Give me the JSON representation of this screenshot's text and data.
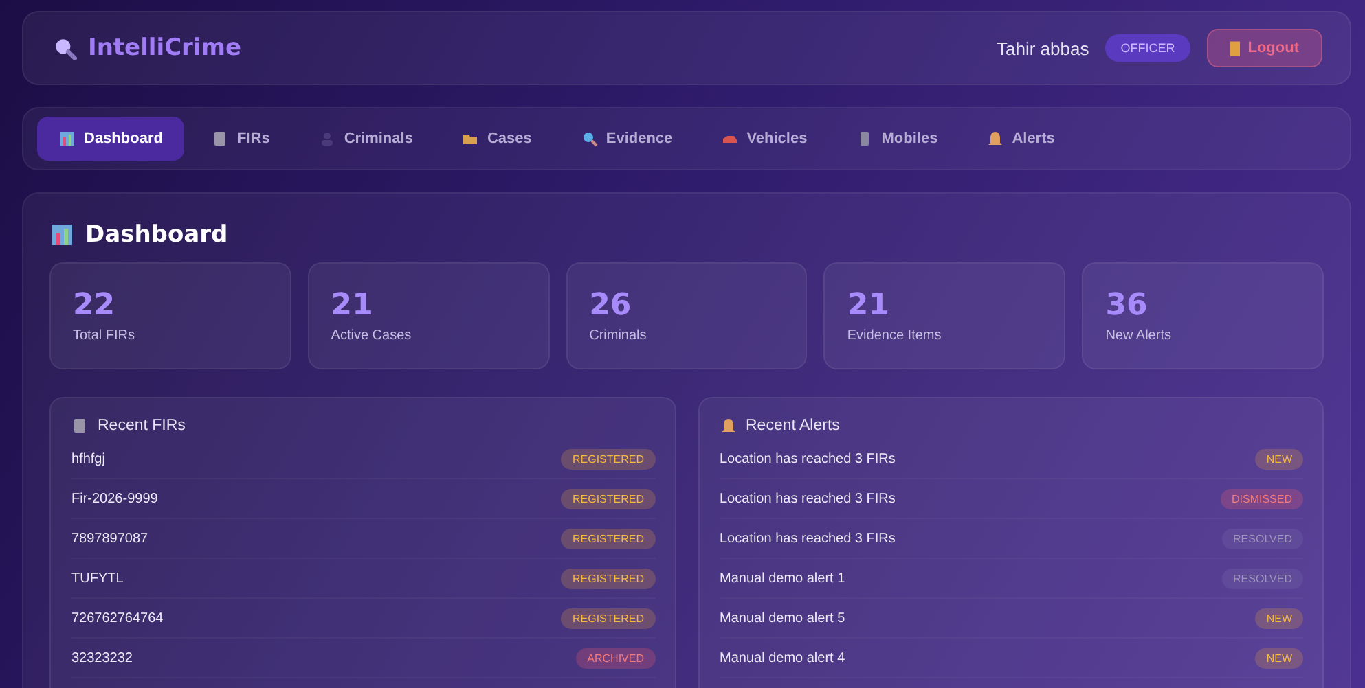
{
  "header": {
    "logo": "IntelliCrime",
    "user": "Tahir abbas",
    "role": "OFFICER",
    "logout": "Logout"
  },
  "nav": [
    {
      "label": "Dashboard",
      "selected": true
    },
    {
      "label": "FIRs",
      "selected": false
    },
    {
      "label": "Criminals",
      "selected": false
    },
    {
      "label": "Cases",
      "selected": false
    },
    {
      "label": "Evidence",
      "selected": false
    },
    {
      "label": "Vehicles",
      "selected": false
    },
    {
      "label": "Mobiles",
      "selected": false
    },
    {
      "label": "Alerts",
      "selected": false
    }
  ],
  "page_title": "Dashboard",
  "stats": [
    {
      "value": "22",
      "label": "Total FIRs"
    },
    {
      "value": "21",
      "label": "Active Cases"
    },
    {
      "value": "26",
      "label": "Criminals"
    },
    {
      "value": "21",
      "label": "Evidence Items"
    },
    {
      "value": "36",
      "label": "New Alerts"
    }
  ],
  "recent_firs": {
    "title": "Recent FIRs",
    "rows": [
      {
        "name": "hfhfgj",
        "status": "REGISTERED",
        "kind": "warning"
      },
      {
        "name": "Fir-2026-9999",
        "status": "REGISTERED",
        "kind": "warning"
      },
      {
        "name": "7897897087",
        "status": "REGISTERED",
        "kind": "warning"
      },
      {
        "name": "TUFYTL",
        "status": "REGISTERED",
        "kind": "warning"
      },
      {
        "name": "726762764764",
        "status": "REGISTERED",
        "kind": "warning"
      },
      {
        "name": "32323232",
        "status": "ARCHIVED",
        "kind": "danger"
      }
    ]
  },
  "recent_alerts": {
    "title": "Recent Alerts",
    "rows": [
      {
        "name": "Location has reached 3 FIRs",
        "status": "NEW",
        "kind": "warning"
      },
      {
        "name": "Location has reached 3 FIRs",
        "status": "DISMISSED",
        "kind": "danger"
      },
      {
        "name": "Location has reached 3 FIRs",
        "status": "RESOLVED",
        "kind": "muted"
      },
      {
        "name": "Manual demo alert 1",
        "status": "RESOLVED",
        "kind": "muted"
      },
      {
        "name": "Manual demo alert 5",
        "status": "NEW",
        "kind": "warning"
      },
      {
        "name": "Manual demo alert 4",
        "status": "NEW",
        "kind": "warning"
      }
    ]
  }
}
